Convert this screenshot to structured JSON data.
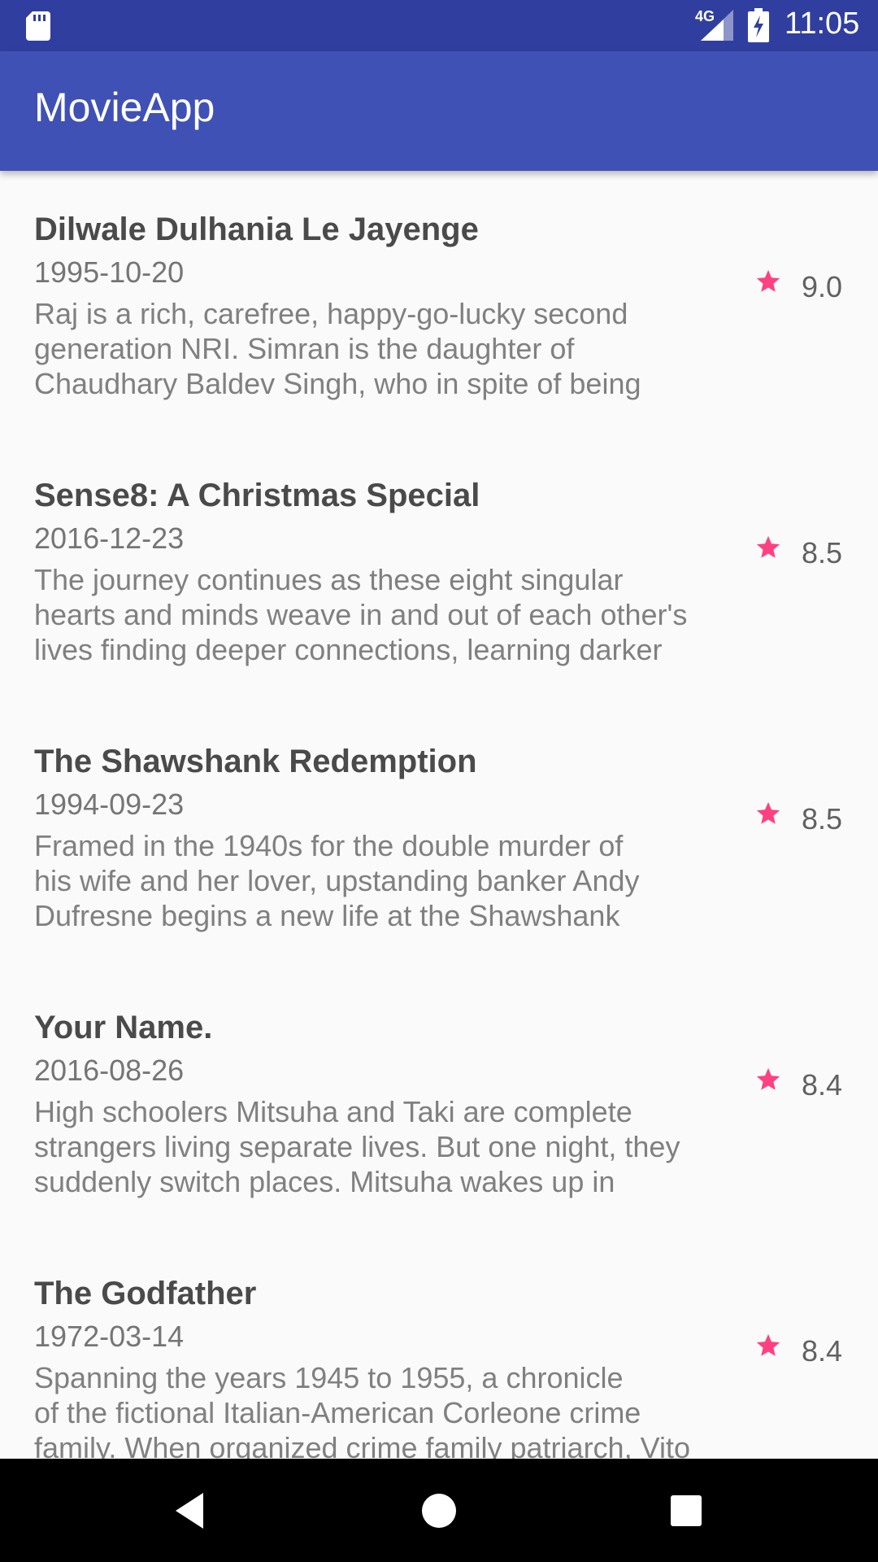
{
  "status_bar": {
    "network": "4G",
    "time": "11:05",
    "icons": [
      "sd-card-icon",
      "cell-signal-icon",
      "battery-charging-icon"
    ]
  },
  "app_bar": {
    "title": "MovieApp",
    "color": "#3F51B5"
  },
  "accent_color": "#FF4081",
  "movies": [
    {
      "title": "Dilwale Dulhania Le Jayenge",
      "release_date": "1995-10-20",
      "overview": "Raj is a rich, carefree, happy-go-lucky second\ngeneration NRI. Simran is the daughter of\nChaudhary Baldev Singh, who in spite of being",
      "rating": "9.0"
    },
    {
      "title": "Sense8: A Christmas Special",
      "release_date": "2016-12-23",
      "overview": "The journey continues as these eight singular\nhearts and minds weave in and out of each other's\nlives finding deeper connections, learning darker",
      "rating": "8.5"
    },
    {
      "title": "The Shawshank Redemption",
      "release_date": "1994-09-23",
      "overview": "Framed in the 1940s for the double murder of\nhis wife and her lover, upstanding banker Andy\nDufresne begins a new life at the Shawshank",
      "rating": "8.5"
    },
    {
      "title": "Your Name.",
      "release_date": "2016-08-26",
      "overview": "High schoolers Mitsuha and Taki are complete\nstrangers living separate lives. But one night, they\nsuddenly switch places. Mitsuha wakes up in",
      "rating": "8.4"
    },
    {
      "title": "The Godfather",
      "release_date": "1972-03-14",
      "overview": "Spanning the years 1945 to 1955, a chronicle\nof the fictional Italian-American Corleone crime\nfamily. When organized crime family patriarch, Vito",
      "rating": "8.4"
    }
  ],
  "nav_bar": {
    "buttons": [
      "back-icon",
      "home-icon",
      "recents-icon"
    ]
  }
}
